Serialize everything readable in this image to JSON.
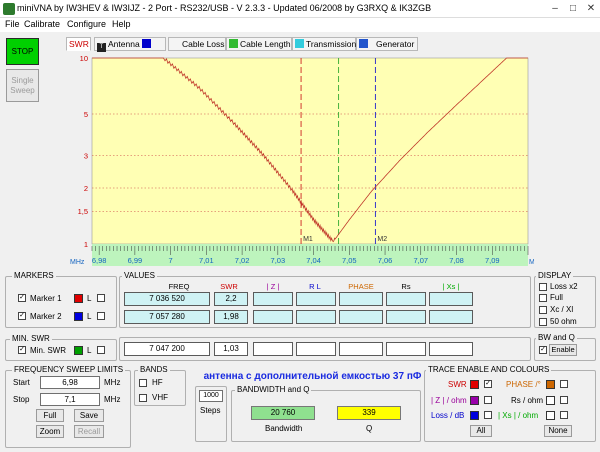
{
  "window": {
    "title": "miniVNA by IW3HEV & IW3IJZ - 2 Port - RS232/USB - V 2.3.3 - Updated 06/2008 by G3RXQ & IK3ZGB"
  },
  "menu": [
    "File",
    "Calibrate",
    "Configure",
    "Help"
  ],
  "buttons": {
    "stop": "STOP",
    "single_sweep_1": "Single",
    "single_sweep_2": "Sweep"
  },
  "tabs": [
    {
      "label": "SWR",
      "color": "#ffffff"
    },
    {
      "label": "Antenna",
      "color": "#0000cc"
    },
    {
      "label": "Cable Loss",
      "color": "#00aa00"
    },
    {
      "label": "Cable Length",
      "color": "#00bcd4"
    },
    {
      "label": "Transmission",
      "color": "#0000cc"
    },
    {
      "label": "Generator",
      "color": ""
    }
  ],
  "chart_data": {
    "type": "line",
    "title": "",
    "xlabel": "MHz",
    "ylabel": "SWR",
    "x_ticks": [
      "6,98",
      "6,99",
      "7",
      "7,01",
      "7,02",
      "7,03",
      "7,04",
      "7,05",
      "7,06",
      "7,07",
      "7,08",
      "7,09"
    ],
    "y_ticks": [
      "10",
      "5",
      "3",
      "2",
      "1,5",
      "1"
    ],
    "xlim": [
      6.978,
      7.1
    ],
    "ylim": [
      1,
      10
    ],
    "scale": "log",
    "series": [
      {
        "color": "#c0392b",
        "x": [
          6.978,
          6.998,
          7.008,
          7.018,
          7.026,
          7.034,
          7.04,
          7.0455,
          7.05,
          7.056,
          7.064,
          7.072,
          7.08,
          7.088,
          7.094,
          7.1
        ],
        "y": [
          10,
          10,
          6.9,
          4.4,
          3.0,
          1.95,
          1.35,
          1.03,
          1.35,
          1.9,
          2.8,
          4.0,
          5.6,
          7.8,
          10,
          10
        ]
      }
    ],
    "markers": [
      {
        "label": "M1",
        "x": 7.0365,
        "color": "#cc2222"
      },
      {
        "label": "M2",
        "x": 7.0573,
        "color": "#2222cc"
      },
      {
        "label": "",
        "x": 7.047,
        "color": "#33aa33"
      }
    ]
  },
  "markers_panel": {
    "title": "MARKERS",
    "marker1": "Marker 1",
    "marker2": "Marker 2",
    "l": "L",
    "marker1_color": "#e00000",
    "marker2_color": "#0000e0",
    "min_swr_title": "MIN. SWR",
    "min_swr": "Min. SWR",
    "min_swr_color": "#00a000"
  },
  "values": {
    "title": "VALUES",
    "headers": [
      "FREQ",
      "SWR",
      "| Z |",
      "R L",
      "PHASE",
      "Rs",
      "| Xs |"
    ],
    "header_colors": [
      "#000000",
      "#cc0000",
      "#990099",
      "#0000cc",
      "#cc6600",
      "#000000",
      "#00aa00"
    ],
    "row1": {
      "freq": "7 036 520",
      "swr": "2,2"
    },
    "row2": {
      "freq": "7 057 280",
      "swr": "1,98"
    },
    "row3": {
      "freq": "7 047 200",
      "swr": "1,03"
    }
  },
  "display": {
    "title": "DISPLAY",
    "items": [
      "Loss x2",
      "Full",
      "Xc / Xl",
      "50 ohm"
    ]
  },
  "bwq": {
    "title": "BW and Q",
    "enable": "Enable",
    "bandwidth_title": "BANDWIDTH and Q",
    "bandwidth_value": "20 760",
    "q_value": "339",
    "bandwidth_label": "Bandwidth",
    "q_label": "Q"
  },
  "sweep": {
    "title": "FREQUENCY SWEEP LIMITS",
    "start_label": "Start",
    "start_value": "6,98",
    "stop_label": "Stop",
    "stop_value": "7,1",
    "unit": "MHz",
    "full": "Full",
    "save": "Save",
    "zoom": "Zoom",
    "recall": "Recall"
  },
  "bands": {
    "title": "BANDS",
    "hf": "HF",
    "vhf": "VHF"
  },
  "steps": {
    "value": "1000",
    "label": "Steps"
  },
  "note": "антенна с дополнительной емкостью 37 пФ",
  "trace": {
    "title": "TRACE ENABLE AND COLOURS",
    "swr": "SWR",
    "phase": "PHASE /°",
    "z": "| Z | / ohm",
    "rs": "Rs / ohm",
    "loss": "Loss / dB",
    "xs": "| Xs | / ohm",
    "all": "All",
    "none": "None",
    "swr_color": "#e00000",
    "phase_color": "#cc6600",
    "z_color": "#9900aa",
    "rs_color": "#ffffff",
    "loss_color": "#0000dd",
    "xs_color": "#ffffff"
  }
}
